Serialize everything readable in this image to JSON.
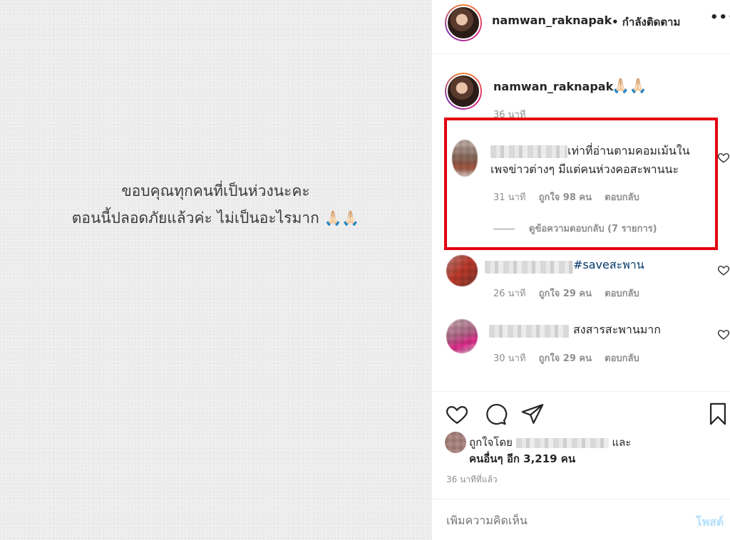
{
  "post_image": {
    "line1": "ขอบคุณทุกคนที่เป็นห่วงนะคะ",
    "line2_text": "ตอนนี้ปลอดภัยแล้วค่ะ ไม่เป็นอะไรมาก",
    "line2_emoji": "🙏🏻🙏🏻"
  },
  "header": {
    "username": "namwan_raknapak",
    "follow_status": "• กำลังติดตาม",
    "more": "•••"
  },
  "caption": {
    "username": "namwan_raknapak",
    "emoji": "🙏🏻🙏🏻",
    "time": "36 นาที"
  },
  "comments": [
    {
      "text_line1": "เท่าที่อ่านตามคอมเม้นใน",
      "text_line2": "เพจข่าวต่างๆ มีแต่คนห่วงคอสะพานนะ",
      "time": "31 นาที",
      "likes": "ถูกใจ 98 คน",
      "reply": "ตอบกลับ",
      "view_replies": "ดูข้อความตอบกลับ (7 รายการ)"
    },
    {
      "hashtag": "#saveสะพาน",
      "time": "26 นาที",
      "likes": "ถูกใจ 29 คน",
      "reply": "ตอบกลับ"
    },
    {
      "text": "สงสารสะพานมาก",
      "time": "30 นาที",
      "likes": "ถูกใจ 29 คน",
      "reply": "ตอบกลับ"
    }
  ],
  "likes_summary": {
    "prefix": "ถูกใจโดย",
    "suffix": "และ",
    "others": "คนอื่นๆ อีก 3,219 คน"
  },
  "post_time": "36 นาทีที่แล้ว",
  "comment_input": {
    "placeholder": "เพิ่มความคิดเห็น",
    "post_label": "โพสต์"
  },
  "colors": {
    "highlight": "#e3000f",
    "post_button": "#b2dffc",
    "hashtag": "#00376b"
  }
}
